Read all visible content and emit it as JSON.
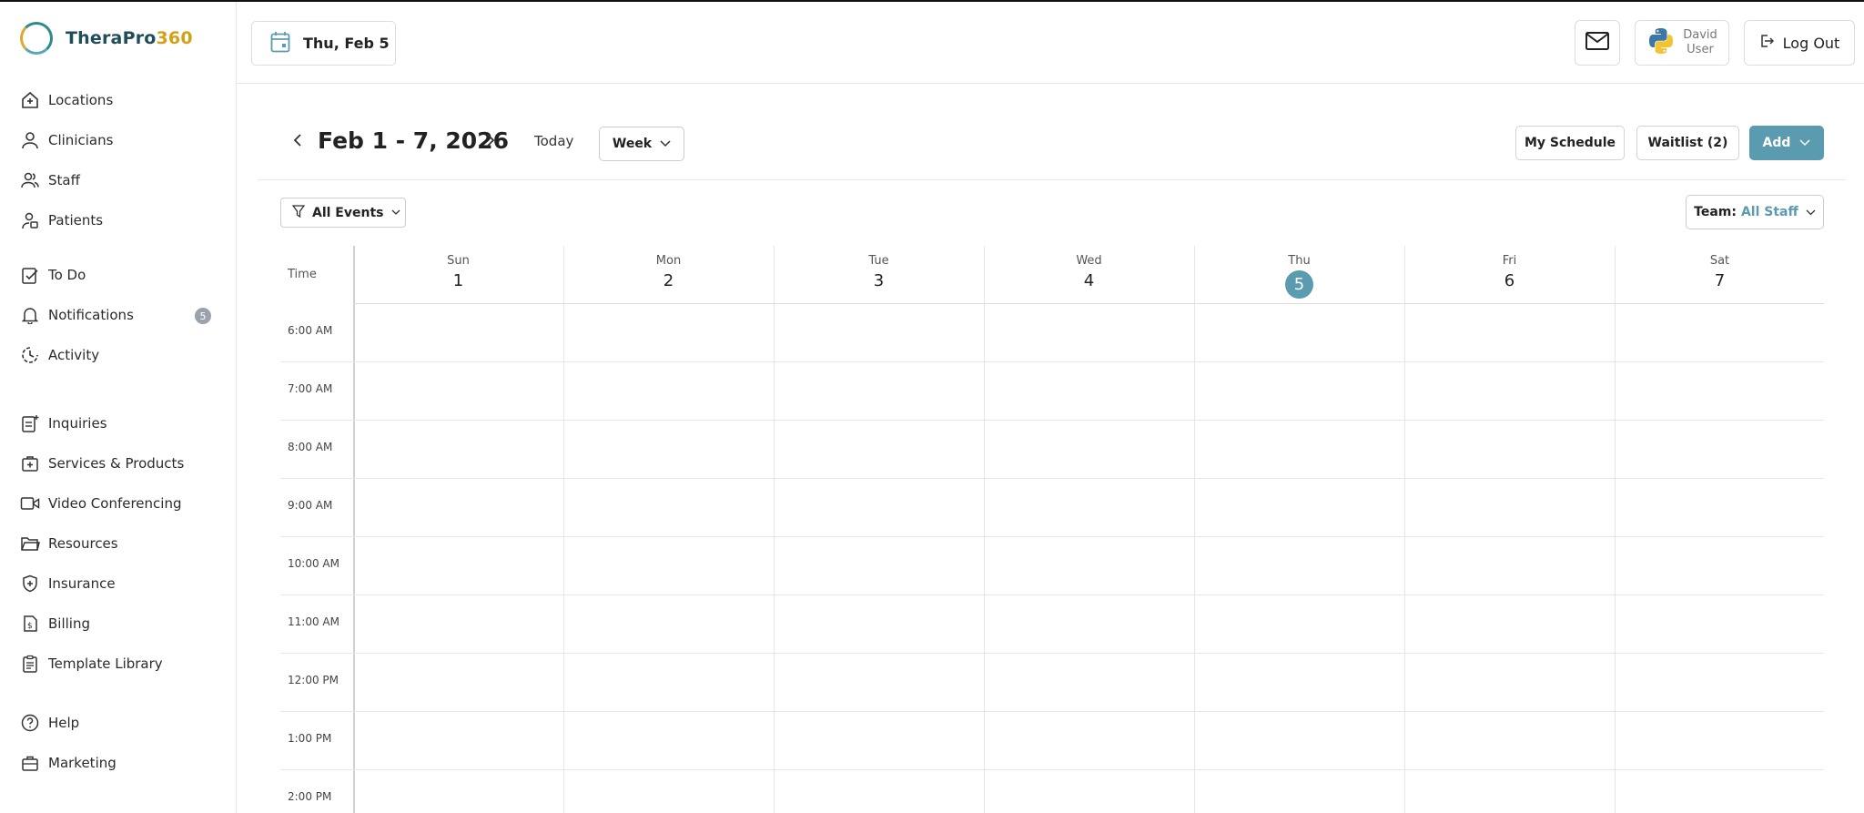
{
  "brand": {
    "name_part1": "TheraPro",
    "name_part2": "360"
  },
  "sidebar": {
    "groups": [
      [
        {
          "label": "Locations",
          "icon": "home-plus-icon"
        },
        {
          "label": "Clinicians",
          "icon": "person-icon"
        },
        {
          "label": "Staff",
          "icon": "people-icon"
        },
        {
          "label": "Patients",
          "icon": "patient-icon"
        }
      ],
      [
        {
          "label": "To Do",
          "icon": "todo-icon"
        },
        {
          "label": "Notifications",
          "icon": "bell-icon",
          "badge": "5"
        },
        {
          "label": "Activity",
          "icon": "activity-icon"
        }
      ],
      [
        {
          "label": "Inquiries",
          "icon": "inquiries-icon"
        },
        {
          "label": "Services & Products",
          "icon": "services-icon"
        },
        {
          "label": "Video Conferencing",
          "icon": "video-icon"
        },
        {
          "label": "Resources",
          "icon": "folder-icon"
        },
        {
          "label": "Insurance",
          "icon": "shield-icon"
        },
        {
          "label": "Billing",
          "icon": "billing-icon"
        },
        {
          "label": "Template Library",
          "icon": "template-icon"
        }
      ],
      [
        {
          "label": "Help",
          "icon": "help-icon"
        },
        {
          "label": "Marketing",
          "icon": "briefcase-icon"
        }
      ]
    ]
  },
  "header": {
    "current_date": "Thu, Feb 5",
    "user_name": "David",
    "user_role": "User",
    "logout_label": "Log Out"
  },
  "toolbar": {
    "range": "Feb 1 - 7, 2026",
    "today_label": "Today",
    "view_label": "Week",
    "my_schedule_label": "My Schedule",
    "waitlist_label": "Waitlist (2)",
    "add_label": "Add"
  },
  "filters": {
    "events_label": "All Events",
    "team_label": "Team:",
    "team_value": "All Staff"
  },
  "calendar": {
    "time_header": "Time",
    "days": [
      {
        "name": "Sun",
        "date": "1"
      },
      {
        "name": "Mon",
        "date": "2"
      },
      {
        "name": "Tue",
        "date": "3"
      },
      {
        "name": "Wed",
        "date": "4"
      },
      {
        "name": "Thu",
        "date": "5",
        "today": true
      },
      {
        "name": "Fri",
        "date": "6"
      },
      {
        "name": "Sat",
        "date": "7"
      }
    ],
    "times": [
      "6:00 AM",
      "7:00 AM",
      "8:00 AM",
      "9:00 AM",
      "10:00 AM",
      "11:00 AM",
      "12:00 PM",
      "1:00 PM",
      "2:00 PM"
    ]
  },
  "colors": {
    "accent": "#5b9bb0",
    "badge": "#9aa3ad",
    "brand_dark": "#1f4e5a",
    "brand_gold": "#d4a017"
  }
}
